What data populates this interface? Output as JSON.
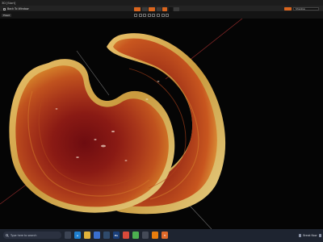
{
  "window": {
    "title": "3D [Start]"
  },
  "toolbar": {
    "back_label": "Back To Window",
    "center_buttons": [
      {
        "icon": "orange-tool-icon",
        "color": "#d9651e"
      },
      {
        "icon": "cube-icon",
        "color": "#3a3a3a"
      },
      {
        "icon": "orange-mode-icon",
        "color": "#d9651e"
      },
      {
        "icon": "grid-icon",
        "color": "#3a3a3a"
      },
      {
        "icon": "orange-option-icon",
        "color": "#d9651e"
      },
      {
        "icon": "black-square-icon",
        "color": "#141414"
      },
      {
        "icon": "layers-icon",
        "color": "#3a3a3a"
      }
    ],
    "right_dropdown_color": "#d9651e",
    "right_select": "Shadow"
  },
  "viewbar": {
    "view_label": "Fixed",
    "tools": [
      "select-icon",
      "move-icon",
      "rotate-icon",
      "scale-icon",
      "camera-icon",
      "light-icon",
      "measure-icon",
      "snap-icon"
    ]
  },
  "viewport": {
    "object": "reishi-mushroom-scan",
    "axis_color": "#cc3b3b"
  },
  "taskbar": {
    "search_placeholder": "Type here to search",
    "apps": [
      {
        "name": "task-view-icon",
        "label": "",
        "color": "#3c4454"
      },
      {
        "name": "edge-icon",
        "label": "e",
        "color": "#1f7fcf"
      },
      {
        "name": "explorer-icon",
        "label": "",
        "color": "#e2b33a"
      },
      {
        "name": "store-icon",
        "label": "",
        "color": "#3a6fcf"
      },
      {
        "name": "steam-icon",
        "label": "",
        "color": "#2f4a6b"
      },
      {
        "name": "photoshop-icon",
        "label": "Ps",
        "color": "#1a3f7a"
      },
      {
        "name": "music-icon",
        "label": "",
        "color": "#d94a3a"
      },
      {
        "name": "chrome-icon",
        "label": "",
        "color": "#4caf50"
      },
      {
        "name": "app-dark-icon",
        "label": "",
        "color": "#444a57"
      },
      {
        "name": "blender-icon",
        "label": "",
        "color": "#e87d0d"
      },
      {
        "name": "app-t-icon",
        "label": "T",
        "color": "#e06a2a"
      }
    ],
    "tray_text": "Break Now"
  }
}
